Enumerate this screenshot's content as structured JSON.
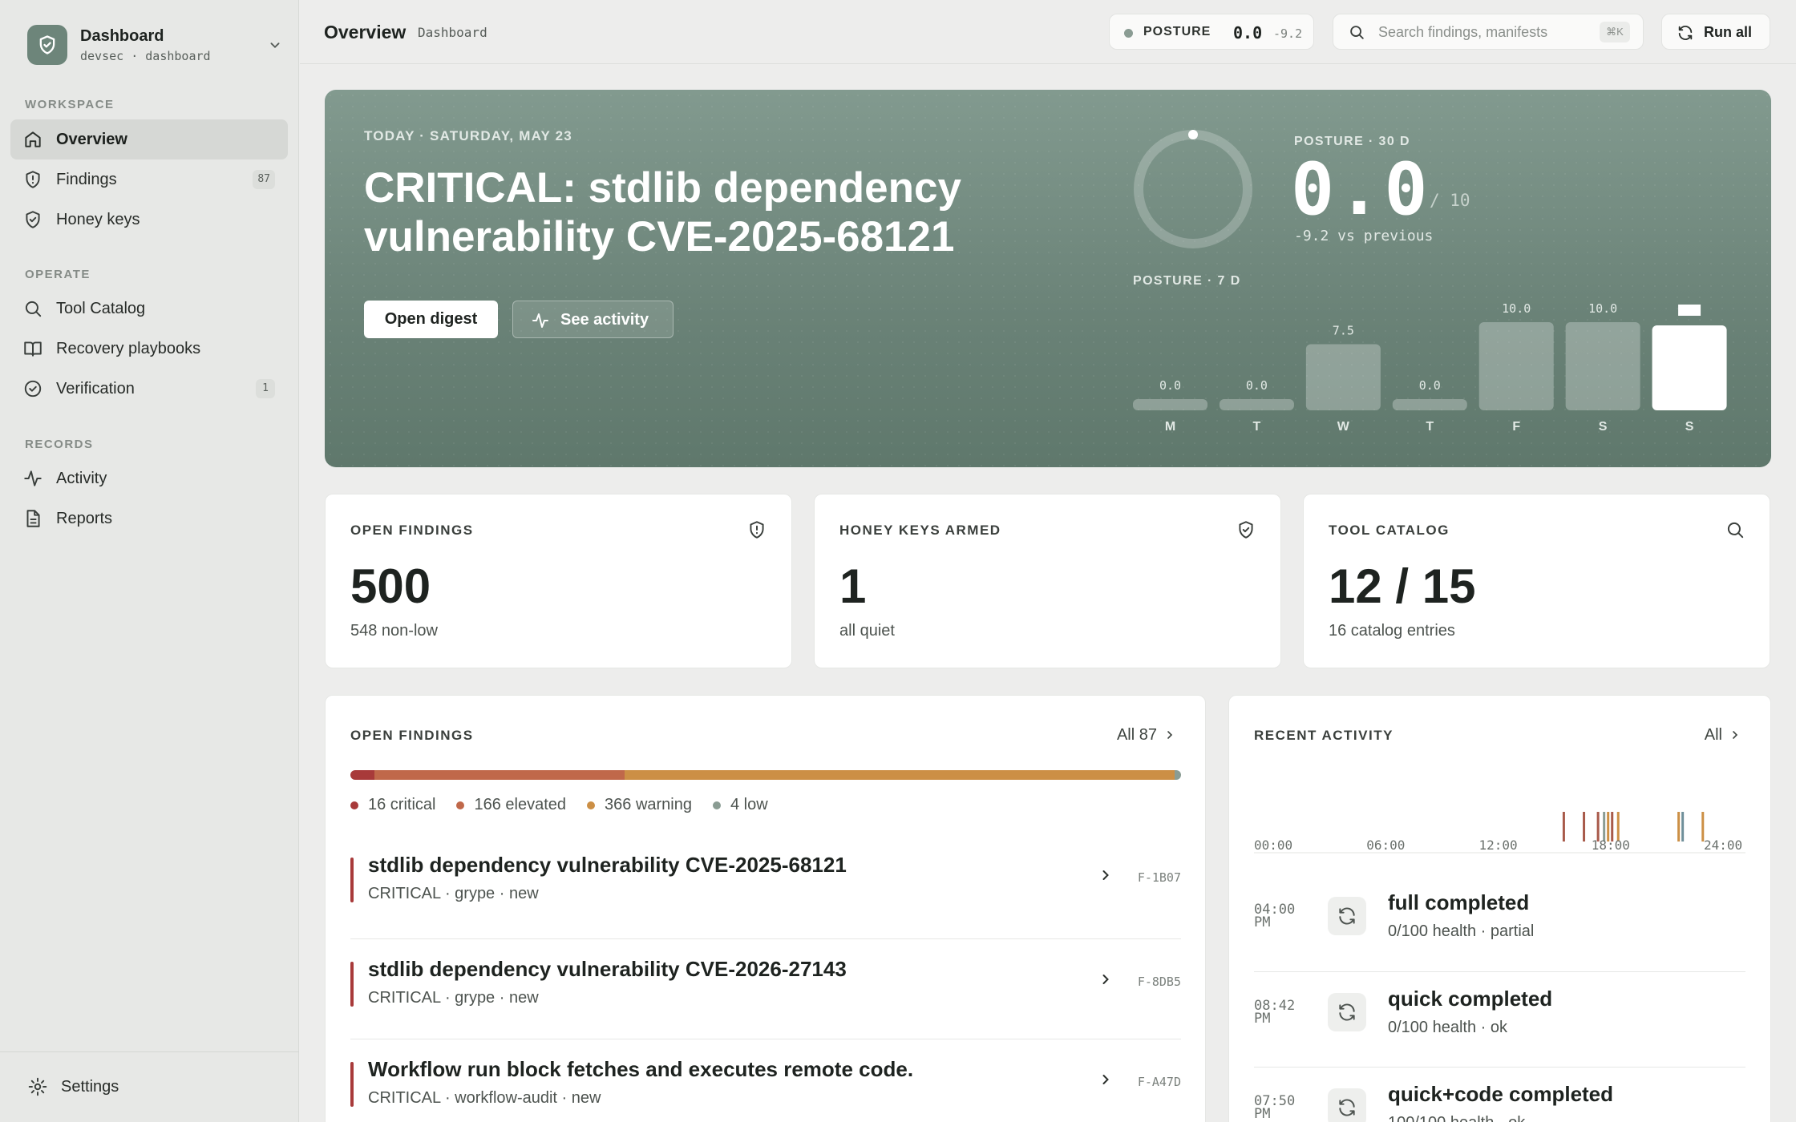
{
  "sidebar": {
    "brand_title": "Dashboard",
    "brand_sub": "devsec · dashboard",
    "sections": [
      {
        "label": "WORKSPACE"
      },
      {
        "label": "OPERATE"
      },
      {
        "label": "RECORDS"
      }
    ],
    "items": [
      {
        "label": "Overview",
        "icon": "home-icon"
      },
      {
        "label": "Findings",
        "icon": "shield-alert-icon",
        "badge": "87"
      },
      {
        "label": "Honey keys",
        "icon": "shield-check-icon"
      },
      {
        "label": "Tool Catalog",
        "icon": "search-icon"
      },
      {
        "label": "Recovery playbooks",
        "icon": "book-icon"
      },
      {
        "label": "Verification",
        "icon": "check-circle-icon",
        "badge": "1"
      },
      {
        "label": "Activity",
        "icon": "activity-icon"
      },
      {
        "label": "Reports",
        "icon": "file-text-icon"
      }
    ],
    "settings_label": "Settings"
  },
  "topbar": {
    "title": "Overview",
    "crumb": "Dashboard",
    "posture_label": "POSTURE",
    "posture_value": "0.0",
    "posture_delta": "-9.2",
    "search_placeholder": "Search findings, manifests",
    "search_kbd": "⌘K",
    "run_all_label": "Run all"
  },
  "hero": {
    "date": "TODAY · SATURDAY, MAY 23",
    "title": "CRITICAL: stdlib dependency vulnerability CVE-2025-68121",
    "open_digest": "Open digest",
    "see_activity": "See activity",
    "posture30_label": "POSTURE · 30 D",
    "posture30_value": "0.0",
    "posture30_max": "/ 10",
    "posture30_delta": "-9.2 vs previous",
    "posture30_ring_fraction": 0,
    "posture7_label": "POSTURE · 7 D"
  },
  "chart_data": {
    "type": "bar",
    "categories": [
      "M",
      "T",
      "W",
      "T",
      "F",
      "S",
      "S"
    ],
    "values": [
      0.0,
      0.0,
      7.5,
      0.0,
      10.0,
      10.0,
      null
    ],
    "value_labels": [
      "0.0",
      "0.0",
      "7.5",
      "0.0",
      "10.0",
      "10.0",
      ""
    ],
    "ylim": [
      0,
      10
    ],
    "highlight_index": 6
  },
  "stats": [
    {
      "label": "OPEN FINDINGS",
      "value": "500",
      "sub": "548 non-low",
      "icon": "shield-alert-icon"
    },
    {
      "label": "HONEY KEYS ARMED",
      "value": "1",
      "sub": "all quiet",
      "icon": "shield-check-icon"
    },
    {
      "label": "TOOL CATALOG",
      "value": "12 / 15",
      "sub": "16 catalog entries",
      "icon": "search-icon"
    }
  ],
  "findings": {
    "title": "OPEN FINDINGS",
    "all_link": "All 87",
    "severity": [
      {
        "label": "16 critical",
        "count": 16,
        "color": "#a83a3a"
      },
      {
        "label": "166 elevated",
        "count": 166,
        "color": "#c0684a"
      },
      {
        "label": "366 warning",
        "count": 366,
        "color": "#cc8f45"
      },
      {
        "label": "4 low",
        "count": 4,
        "color": "#8a9c93"
      }
    ],
    "rows": [
      {
        "title": "stdlib dependency vulnerability CVE-2025-68121",
        "meta": "CRITICAL · grype · new",
        "id": "F-1B07"
      },
      {
        "title": "stdlib dependency vulnerability CVE-2026-27143",
        "meta": "CRITICAL · grype · new",
        "id": "F-8DB5"
      },
      {
        "title": "Workflow run block fetches and executes remote code.",
        "meta": "CRITICAL · workflow-audit · new",
        "id": "F-A47D"
      }
    ]
  },
  "activity": {
    "title": "RECENT ACTIVITY",
    "all_link": "All",
    "axis_ticks": [
      "00:00",
      "06:00",
      "12:00",
      "18:00",
      "24:00"
    ],
    "events": [
      {
        "hour": 15.3,
        "color": "#a85a4a"
      },
      {
        "hour": 16.3,
        "color": "#a85a4a"
      },
      {
        "hour": 17.0,
        "color": "#a85a4a"
      },
      {
        "hour": 17.3,
        "color": "#8a9c93"
      },
      {
        "hour": 17.5,
        "color": "#cc8f45"
      },
      {
        "hour": 17.7,
        "color": "#a85a4a"
      },
      {
        "hour": 18.0,
        "color": "#cc8f45"
      },
      {
        "hour": 21.0,
        "color": "#cc8f45"
      },
      {
        "hour": 21.2,
        "color": "#6f8f9a"
      },
      {
        "hour": 22.2,
        "color": "#cc8f45"
      }
    ],
    "rows": [
      {
        "time": "04:00 PM",
        "title": "full completed",
        "sub": "0/100 health · partial"
      },
      {
        "time": "08:42 PM",
        "title": "quick completed",
        "sub": "0/100 health · ok"
      },
      {
        "time": "07:50 PM",
        "title": "quick+code completed",
        "sub": "100/100 health · ok"
      }
    ]
  }
}
